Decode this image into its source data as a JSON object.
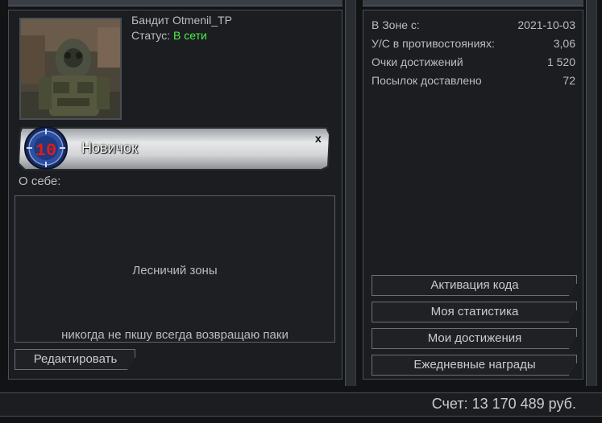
{
  "profile": {
    "name": "Бандит Otmenil_TP",
    "status_label": "Статус:",
    "status_value": "В сети",
    "rank_level": "10",
    "rank_title": "Новичок",
    "rank_close": "x",
    "about_label": "О себе:",
    "about_line1": "Лесничий зоны",
    "about_line2": "никогда не пкшу всегда возвращаю паки",
    "edit_button": "Редактировать"
  },
  "stats": [
    {
      "label": "В Зоне с:",
      "value": "2021-10-03"
    },
    {
      "label": "У/С в противостояниях:",
      "value": "3,06"
    },
    {
      "label": "Очки достижений",
      "value": "1 520"
    },
    {
      "label": "Посылок доставлено",
      "value": "72"
    }
  ],
  "actions": {
    "activate_code": "Активация кода",
    "my_stats": "Моя статистика",
    "my_achievements": "Мои достижения",
    "daily_rewards": "Ежедневные награды"
  },
  "footer": {
    "balance": "Счет: 13 170 489 руб."
  },
  "colors": {
    "online": "#4cf04c",
    "panel_bg": "#1b1d20",
    "border": "#4a4f55"
  },
  "icons": {
    "avatar": "armored-stalker-avatar",
    "rank_badge": "rank-10-badge-icon"
  }
}
